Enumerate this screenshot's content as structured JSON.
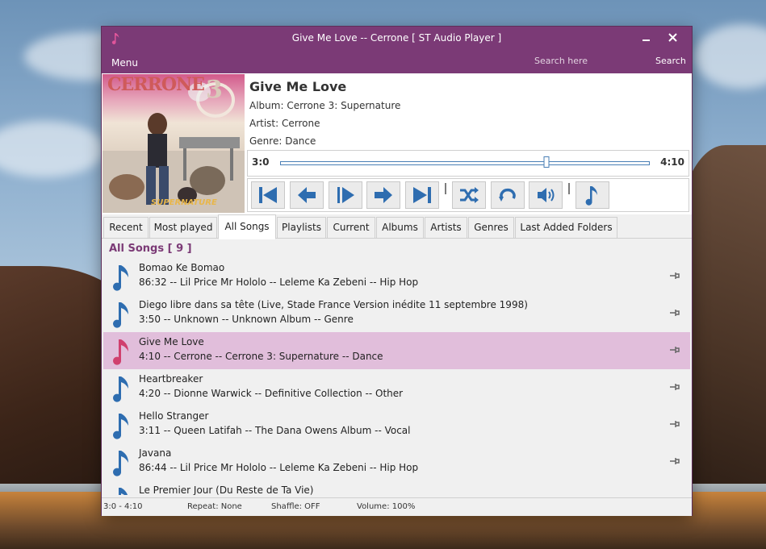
{
  "window": {
    "title": "Give Me Love -- Cerrone [ ST Audio Player ]",
    "menu_label": "Menu",
    "search_placeholder": "Search here",
    "search_button": "Search",
    "accent_color": "#7b3a76",
    "selected_row_color": "#e1bedb"
  },
  "now_playing": {
    "album_art_title": "CERRONE",
    "album_art_number": "3",
    "album_art_subtitle": "SUPERNATURE",
    "title": "Give Me Love",
    "album": "Album: Cerrone 3: Supernature",
    "artist": "Artist: Cerrone",
    "genre": "Genre: Dance",
    "elapsed": "3:0",
    "duration": "4:10",
    "progress_fraction": 0.72
  },
  "controls": [
    {
      "name": "first-track-button",
      "icon": "skip-to-start-icon"
    },
    {
      "name": "previous-button",
      "icon": "arrow-left-icon"
    },
    {
      "name": "play-button",
      "icon": "play-icon"
    },
    {
      "name": "next-button",
      "icon": "arrow-right-icon"
    },
    {
      "name": "last-track-button",
      "icon": "skip-to-end-icon"
    },
    {
      "name": "shuffle-button",
      "icon": "shuffle-icon"
    },
    {
      "name": "repeat-button",
      "icon": "repeat-icon"
    },
    {
      "name": "volume-button",
      "icon": "speaker-icon"
    },
    {
      "name": "music-button",
      "icon": "music-note-icon"
    }
  ],
  "tabs": [
    "Recent",
    "Most played",
    "All Songs",
    "Playlists",
    "Current",
    "Albums",
    "Artists",
    "Genres",
    "Last Added Folders"
  ],
  "active_tab": "All Songs",
  "list": {
    "header": "All Songs [ 9 ]",
    "songs": [
      {
        "title": "Bomao Ke Bomao",
        "details": "86:32 -- Lil Price Mr Hololo -- Leleme Ka Zebeni -- Hip Hop"
      },
      {
        "title": "Diego libre dans sa tête (Live, Stade France  Version inédite  11 septembre 1998)",
        "details": "3:50 -- Unknown -- Unknown Album -- Genre"
      },
      {
        "title": "Give Me Love",
        "details": "4:10 -- Cerrone -- Cerrone 3: Supernature -- Dance",
        "selected": true
      },
      {
        "title": "Heartbreaker",
        "details": "4:20 -- Dionne Warwick -- Definitive Collection -- Other"
      },
      {
        "title": "Hello Stranger",
        "details": "3:11 -- Queen Latifah -- The Dana Owens Album -- Vocal"
      },
      {
        "title": "Javana",
        "details": "86:44 -- Lil Price Mr Hololo -- Leleme Ka Zebeni -- Hip Hop"
      },
      {
        "title": "Le Premier Jour (Du Reste de Ta Vie)",
        "details": ""
      }
    ]
  },
  "status_bar": {
    "position": "3:0 - 4:10",
    "repeat": "Repeat: None",
    "shuffle": "Shaffle: OFF",
    "volume": "Volume: 100%"
  }
}
